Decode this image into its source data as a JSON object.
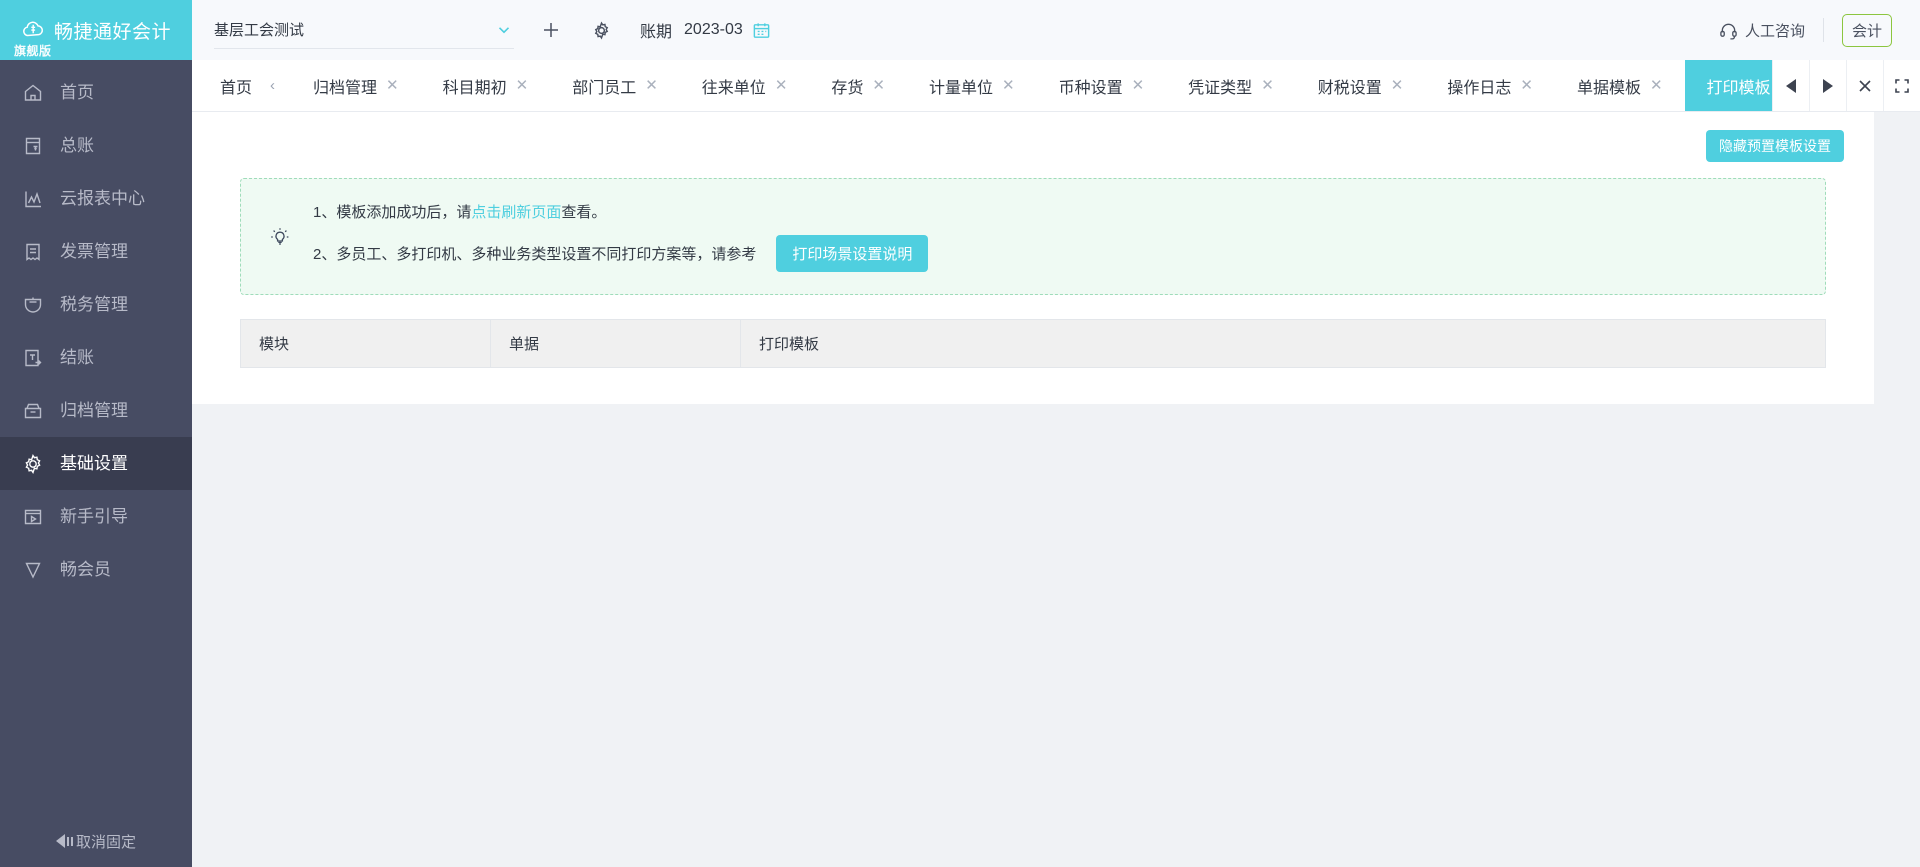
{
  "brand": {
    "name": "畅捷通好会计",
    "edition": "旗舰版",
    "accent": "#4fcfdf",
    "sidebar_bg": "#474c63"
  },
  "sidebar": {
    "items": [
      {
        "label": "首页",
        "icon": "home-icon",
        "active": false
      },
      {
        "label": "总账",
        "icon": "ledger-icon",
        "active": false
      },
      {
        "label": "云报表中心",
        "icon": "chart-icon",
        "active": false
      },
      {
        "label": "发票管理",
        "icon": "invoice-icon",
        "active": false
      },
      {
        "label": "税务管理",
        "icon": "tax-icon",
        "active": false
      },
      {
        "label": "结账",
        "icon": "settle-icon",
        "active": false
      },
      {
        "label": "归档管理",
        "icon": "archive-icon",
        "active": false
      },
      {
        "label": "基础设置",
        "icon": "gear-icon",
        "active": true
      },
      {
        "label": "新手引导",
        "icon": "guide-icon",
        "active": false
      },
      {
        "label": "畅会员",
        "icon": "vip-icon",
        "active": false
      }
    ],
    "pin_label": "取消固定"
  },
  "topbar": {
    "company": "基层工会测试",
    "period_label": "账期",
    "period_value": "2023-03",
    "support_label": "人工咨询",
    "role_badge": "会计",
    "role_badge_border": "#8cc63f"
  },
  "tabstrip": {
    "home_label": "首页",
    "tabs": [
      {
        "label": "归档管理",
        "active": false
      },
      {
        "label": "科目期初",
        "active": false
      },
      {
        "label": "部门员工",
        "active": false
      },
      {
        "label": "往来单位",
        "active": false
      },
      {
        "label": "存货",
        "active": false
      },
      {
        "label": "计量单位",
        "active": false
      },
      {
        "label": "币种设置",
        "active": false
      },
      {
        "label": "凭证类型",
        "active": false
      },
      {
        "label": "财税设置",
        "active": false
      },
      {
        "label": "操作日志",
        "active": false
      },
      {
        "label": "单据模板",
        "active": false
      },
      {
        "label": "打印模板",
        "active": true
      }
    ],
    "close_glyph": "✕"
  },
  "main": {
    "hide_preset_button": "隐藏预置模板设置",
    "notice": {
      "line1_prefix": "1、模板添加成功后，请",
      "line1_link": "点击刷新页面",
      "line1_suffix": "查看。",
      "line2_text": "2、多员工、多打印机、多种业务类型设置不同打印方案等，请参考",
      "line2_button": "打印场景设置说明"
    },
    "table": {
      "columns": [
        "模块",
        "单据",
        "打印模板"
      ],
      "rows": []
    }
  }
}
